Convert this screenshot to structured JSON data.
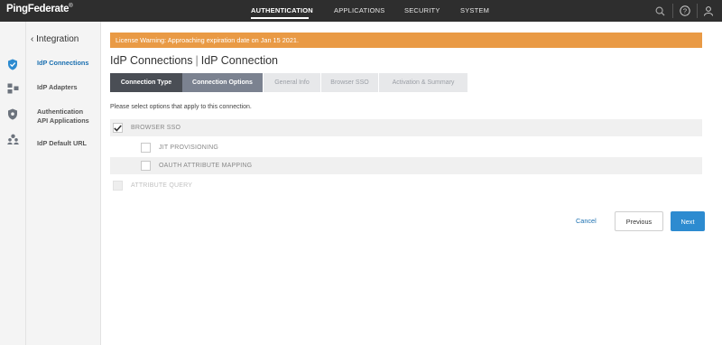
{
  "app": {
    "logo_text": "PingFederate",
    "logo_mark": "®"
  },
  "nav": {
    "items": [
      {
        "label": "AUTHENTICATION"
      },
      {
        "label": "APPLICATIONS"
      },
      {
        "label": "SECURITY"
      },
      {
        "label": "SYSTEM"
      }
    ],
    "active": "AUTHENTICATION"
  },
  "top_icons": [
    "search-icon",
    "help-icon",
    "user-icon"
  ],
  "rail_icons": [
    "shield-check-icon",
    "adapters-icon",
    "api-shield-icon",
    "people-icon"
  ],
  "sidebar": {
    "back_label": "Integration",
    "items": [
      {
        "label": "IdP Connections",
        "active": true
      },
      {
        "label": "IdP Adapters"
      },
      {
        "label_line1": "Authentication",
        "label_line2": "API Applications"
      },
      {
        "label": "IdP Default URL"
      }
    ]
  },
  "warning": {
    "text": "License Warning: Approaching expiration date on Jan 15 2021."
  },
  "breadcrumb": {
    "parent": "IdP Connections",
    "separator": "|",
    "current": "IdP Connection"
  },
  "tabs": [
    {
      "label": "Connection Type",
      "state": "done"
    },
    {
      "label": "Connection Options",
      "state": "current"
    },
    {
      "label": "General Info",
      "state": "future"
    },
    {
      "label": "Browser SSO",
      "state": "future"
    },
    {
      "label": "Activation & Summary",
      "state": "future"
    }
  ],
  "instructions": "Please select options that apply to this connection.",
  "options": [
    {
      "label": "BROWSER SSO",
      "checked": true,
      "enabled": true
    },
    {
      "label": "JIT PROVISIONING",
      "checked": false,
      "enabled": true
    },
    {
      "label": "OAUTH ATTRIBUTE MAPPING",
      "checked": false,
      "enabled": true
    },
    {
      "label": "ATTRIBUTE QUERY",
      "checked": false,
      "enabled": false
    }
  ],
  "actions": {
    "cancel": "Cancel",
    "previous": "Previous",
    "next": "Next"
  },
  "colors": {
    "topbar": "#2e2e2e",
    "warning": "#e99a45",
    "accent": "#2d8bd0",
    "link": "#1a6fb0",
    "tab_done": "#4a4e55",
    "tab_current": "#7b8290"
  }
}
